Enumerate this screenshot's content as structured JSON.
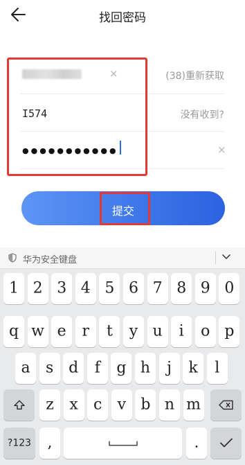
{
  "header": {
    "title": "找回密码",
    "back_icon": "arrow-left-icon"
  },
  "form": {
    "phone": {
      "value_blurred": true,
      "clear_icon": "clear-icon",
      "resend_label": "(38)重新获取"
    },
    "code": {
      "value": "I574",
      "help_label": "没有收到?"
    },
    "password": {
      "masked": "●●●●●●●●●●●",
      "clear_icon": "clear-icon"
    }
  },
  "submit": {
    "label": "提交"
  },
  "keyboard": {
    "name": "华为安全键盘",
    "rows": [
      [
        "1",
        "2",
        "3",
        "4",
        "5",
        "6",
        "7",
        "8",
        "9",
        "0"
      ],
      [
        "q",
        "w",
        "e",
        "r",
        "t",
        "y",
        "u",
        "i",
        "o",
        "p"
      ],
      [
        "a",
        "s",
        "d",
        "f",
        "g",
        "h",
        "j",
        "k",
        "l"
      ],
      [
        "z",
        "x",
        "c",
        "v",
        "b",
        "n",
        "m"
      ]
    ],
    "symbols_label": "?123",
    "comma_label": ",",
    "period_label": "."
  },
  "colors": {
    "accent": "#3f78ea",
    "highlight": "#e53935"
  }
}
